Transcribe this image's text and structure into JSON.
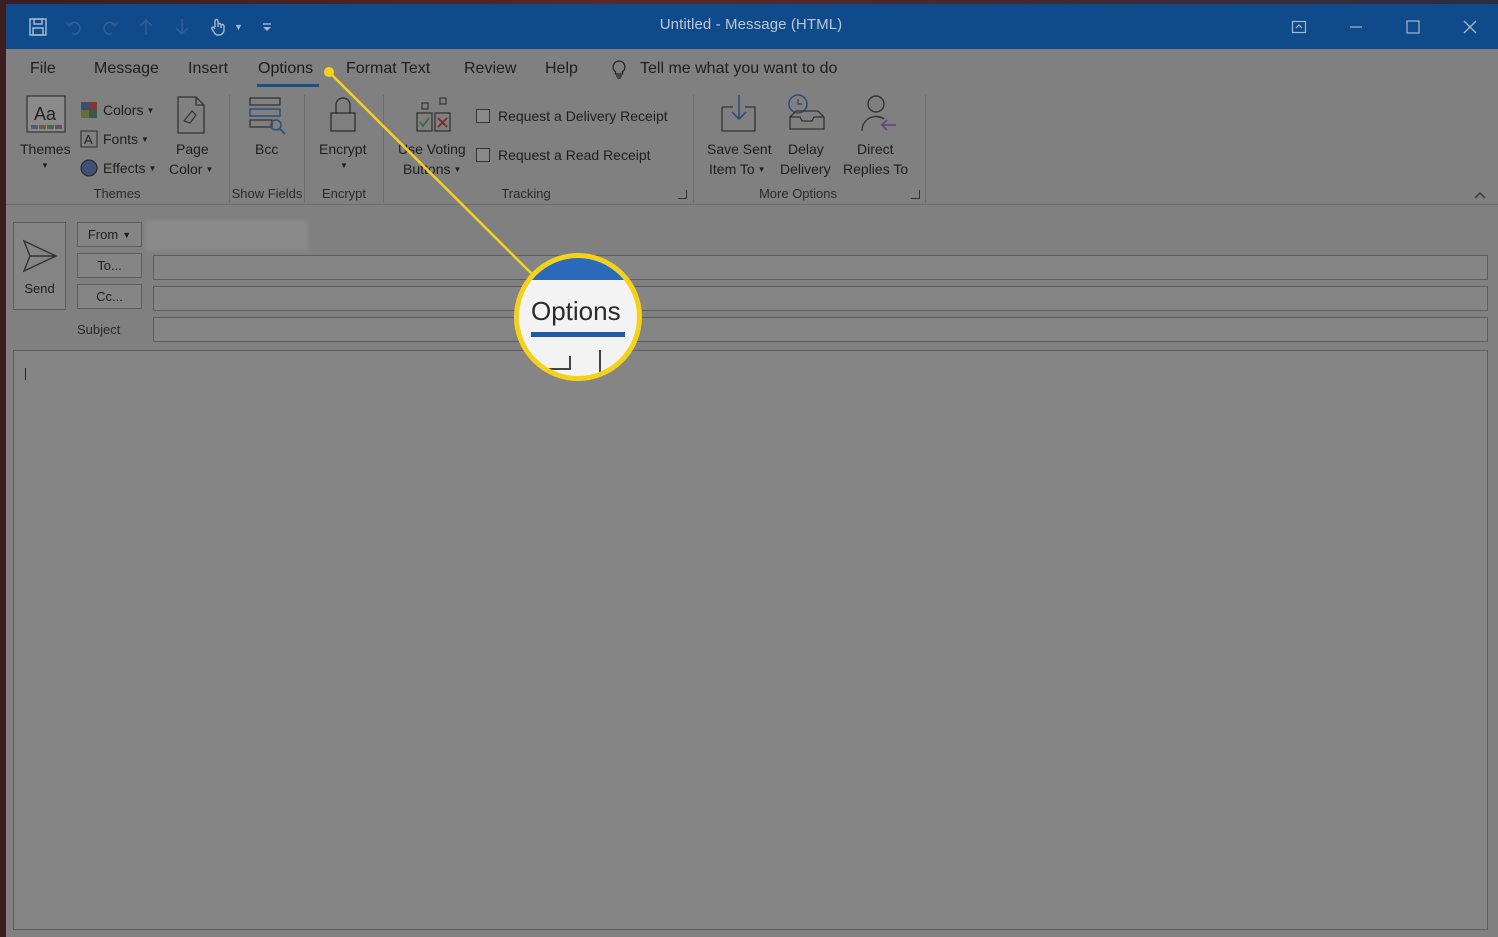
{
  "window": {
    "title": "Untitled  -  Message (HTML)"
  },
  "quick_access": [
    "save-icon",
    "undo-icon",
    "redo-icon",
    "up-arrow-icon",
    "down-arrow-icon",
    "touch-mode-icon",
    "customize-icon"
  ],
  "tabs": [
    {
      "label": "File"
    },
    {
      "label": "Message"
    },
    {
      "label": "Insert"
    },
    {
      "label": "Options",
      "active": true
    },
    {
      "label": "Format Text"
    },
    {
      "label": "Review"
    },
    {
      "label": "Help"
    }
  ],
  "tell_me": "Tell me what you want to do",
  "ribbon": {
    "themes_group": {
      "themes": "Themes",
      "colors": "Colors",
      "fonts": "Fonts",
      "effects": "Effects",
      "page_color_line1": "Page",
      "page_color_line2": "Color",
      "label": "Themes"
    },
    "show_fields_group": {
      "bcc": "Bcc",
      "label": "Show Fields"
    },
    "encrypt_group": {
      "encrypt": "Encrypt",
      "label": "Encrypt"
    },
    "tracking_group": {
      "voting_line1": "Use Voting",
      "voting_line2": "Buttons",
      "delivery_receipt": "Request a Delivery Receipt",
      "read_receipt": "Request a Read Receipt",
      "label": "Tracking"
    },
    "more_options_group": {
      "save_sent_line1": "Save Sent",
      "save_sent_line2": "Item To",
      "delay_line1": "Delay",
      "delay_line2": "Delivery",
      "direct_line1": "Direct",
      "direct_line2": "Replies To",
      "label": "More Options"
    }
  },
  "compose": {
    "send": "Send",
    "from": "From",
    "to": "To...",
    "cc": "Cc...",
    "subject": "Subject"
  },
  "callout": {
    "label": "Options",
    "color": "#f5d21a"
  },
  "colors": {
    "titlebar": "#0f4a8a",
    "accent": "#1f4e86"
  }
}
